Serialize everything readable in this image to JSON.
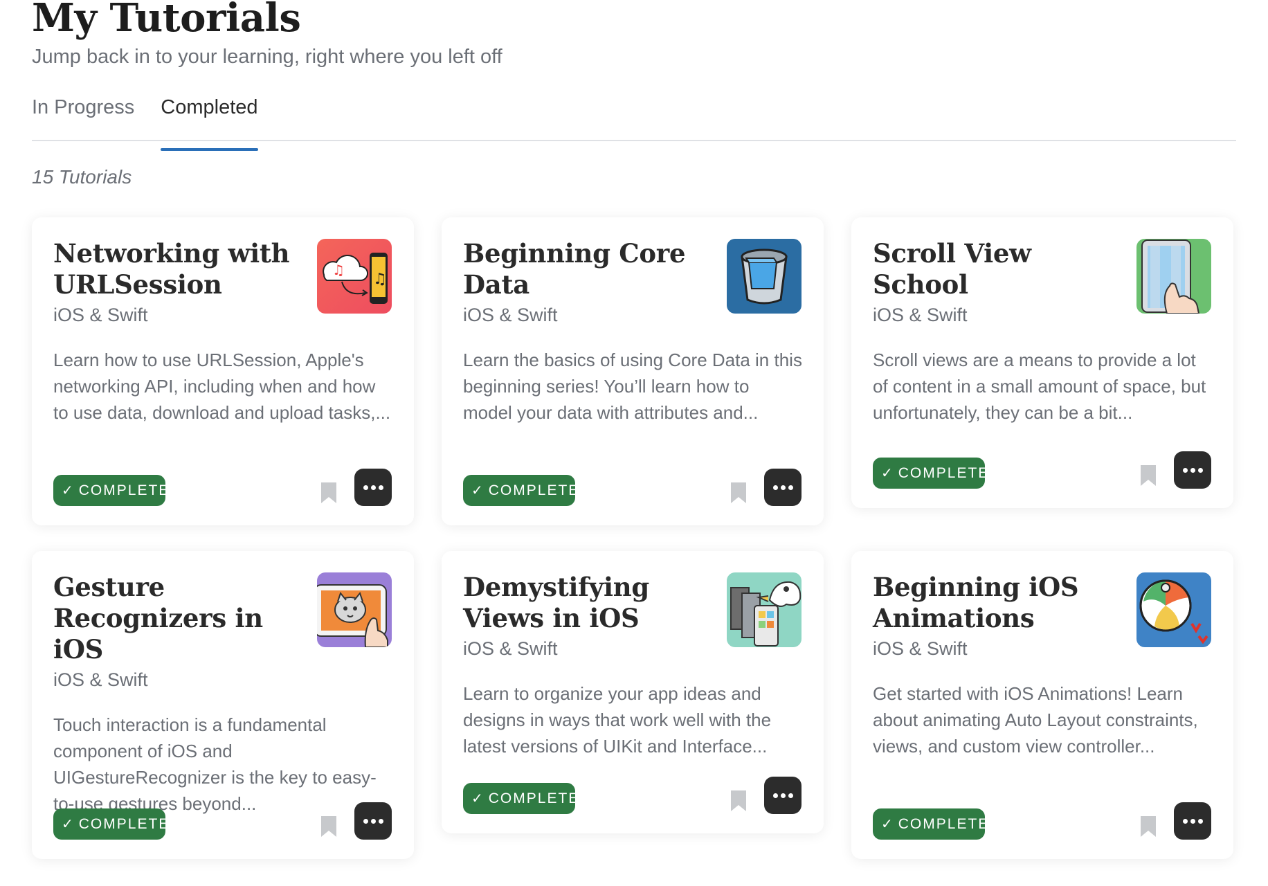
{
  "header": {
    "title": "My Tutorials",
    "subtitle": "Jump back in to your learning, right where you left off"
  },
  "tabs": [
    {
      "label": "In Progress",
      "active": false
    },
    {
      "label": "Completed",
      "active": true
    }
  ],
  "count_label": "15 Tutorials",
  "colors": {
    "accent": "#2a6fb8",
    "complete": "#2f7b43",
    "more_button": "#2c2c2c"
  },
  "cards": [
    {
      "title": "Networking with URLSession",
      "category": "iOS & Swift",
      "description": "Learn how to use URLSession, Apple's networking API, including when and how to use data, download and upload tasks,...",
      "status": "COMPLETE",
      "icon": "cloud-to-phone-music-icon"
    },
    {
      "title": "Beginning Core Data",
      "category": "iOS & Swift",
      "description": "Learn the basics of using Core Data in this beginning series! You’ll learn how to model your data with attributes and...",
      "status": "COMPLETE",
      "icon": "database-bucket-icon"
    },
    {
      "title": "Scroll View School",
      "category": "iOS & Swift",
      "description": "Scroll views are a means to provide a lot of content in a small amount of space, but unfortunately, they can be a bit...",
      "status": "COMPLETE",
      "icon": "scrolling-phone-hand-icon"
    },
    {
      "title": "Gesture Recognizers in iOS",
      "category": "iOS & Swift",
      "description": "Touch interaction is a fundamental component of iOS and UIGestureRecognizer is the key to easy-to-use gestures beyond...",
      "status": "COMPLETE",
      "icon": "cat-on-tablet-icon"
    },
    {
      "title": "Demystifying Views in iOS",
      "category": "iOS & Swift",
      "description": "Learn to organize your app ideas and designs in ways that work well with the latest versions of UIKit and Interface...",
      "status": "COMPLETE",
      "icon": "bird-with-screens-icon"
    },
    {
      "title": "Beginning iOS Animations",
      "category": "iOS & Swift",
      "description": "Get started with iOS Animations! Learn about animating Auto Layout constraints, views, and custom view controller...",
      "status": "COMPLETE",
      "icon": "beach-ball-icon"
    }
  ]
}
